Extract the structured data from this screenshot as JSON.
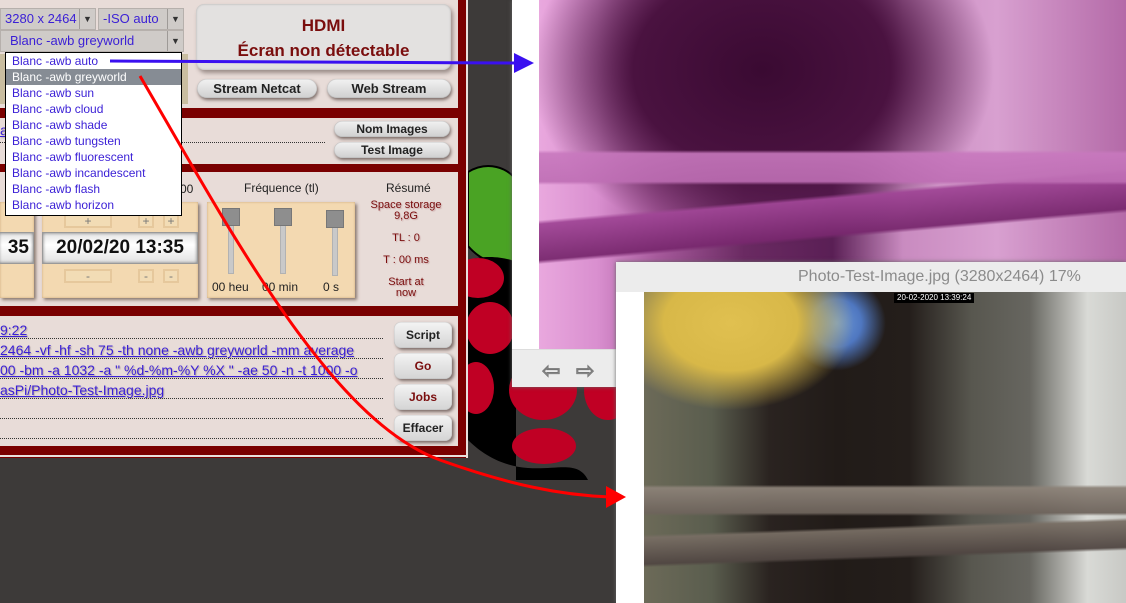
{
  "settings": {
    "resolution": "3280 x 2464",
    "iso": "-ISO auto",
    "awb_selected": "Blanc -awb greyworld",
    "awb_options": [
      "Blanc -awb auto",
      "Blanc -awb greyworld",
      "Blanc -awb sun",
      "Blanc -awb cloud",
      "Blanc -awb shade",
      "Blanc -awb tungsten",
      "Blanc -awb fluorescent",
      "Blanc -awb incandescent",
      "Blanc -awb flash",
      "Blanc -awb horizon"
    ],
    "awb_highlighted_index": 1
  },
  "hdmi": {
    "line1": "HDMI",
    "line2": "Écran non détectable"
  },
  "stream": {
    "netcat_label": "Stream  Netcat",
    "web_label": "Web Stream"
  },
  "images": {
    "partial_label": "a",
    "nom_images_label": "Nom Images",
    "test_image_label": "Test Image"
  },
  "timelapse": {
    "partial_header": "00",
    "left_time_partial": "35",
    "datetime": "20/02/20  13:35",
    "plus": "+",
    "minus": "-",
    "frequency_title": "Fréquence (tl)",
    "sliders": [
      {
        "label": "00 heu",
        "value": 0
      },
      {
        "label": "00 min",
        "value": 0
      },
      {
        "label": "0 s",
        "value": 0
      }
    ],
    "resume_title": "Résumé",
    "resume": {
      "storage": "Space storage\n9,8G",
      "storage_l1": "Space storage",
      "storage_l2": "9,8G",
      "tl": "TL : 0",
      "t": "T : 00 ms",
      "start_l1": "Start at",
      "start_l2": "now"
    }
  },
  "script": {
    "lines": [
      "9:22",
      " 2464 -vf -hf -sh 75 -th none -awb greyworld -mm average",
      "00  -bm -a 1032 -a \" %d-%m-%Y %X \" -ae 50 -n -t 1000 -o",
      "asPi/Photo-Test-Image.jpg"
    ],
    "buttons": {
      "script": "Script",
      "go": "Go",
      "jobs": "Jobs",
      "effacer": "Effacer"
    }
  },
  "viewer1": {
    "nav_prev": "⇦",
    "nav_next": "⇨"
  },
  "viewer2": {
    "title": "Photo-Test-Image.jpg (3280x2464) 17%",
    "timestamp": "20-02-2020  13:39:24"
  },
  "annotations": {
    "blue_arrow_color": "#3a10f0",
    "red_arrow_color": "#ff0000"
  }
}
